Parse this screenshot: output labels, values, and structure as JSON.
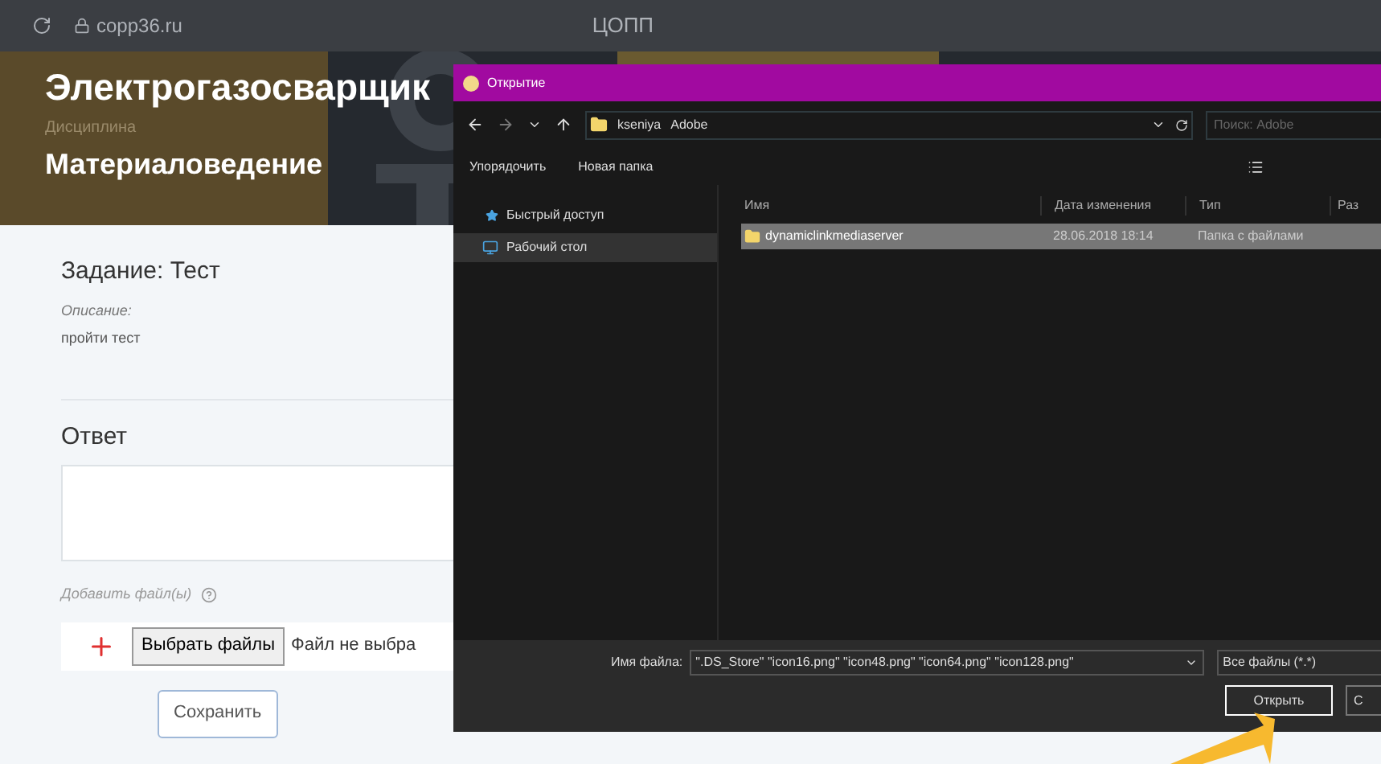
{
  "browser": {
    "url": "copp36.ru",
    "title": "ЦОПП"
  },
  "header": {
    "title": "Электрогазосварщик",
    "subtitle_label": "Дисциплина",
    "subtitle": "Материаловедение"
  },
  "task": {
    "title": "Задание: Тест",
    "description_label": "Описание:",
    "description": "пройти тест",
    "answer_label": "Ответ",
    "attach_label": "Добавить файл(ы)",
    "choose_button": "Выбрать файлы",
    "no_file": "Файл не выбра",
    "save_button": "Сохранить"
  },
  "dialog": {
    "title": "Открытие",
    "breadcrumbs": [
      "kseniya",
      "Adobe"
    ],
    "search": {
      "placeholder": "Поиск: Adobe"
    },
    "toolbar": [
      "Упорядочить",
      "Новая папка"
    ],
    "sidebar": [
      {
        "label": "Быстрый доступ",
        "kind": "star",
        "selected": false
      },
      {
        "label": "Рабочий стол",
        "kind": "desktop",
        "selected": true
      }
    ],
    "columns": [
      "Имя",
      "Дата изменения",
      "Тип",
      "Раз"
    ],
    "rows": [
      {
        "name": "dynamiclinkmediaserver",
        "date": "28.06.2018 18:14",
        "type": "Папка с файлами",
        "selected": true
      }
    ],
    "filename_label": "Имя файла:",
    "filename": "\".DS_Store\" \"icon16.png\" \"icon48.png\" \"icon64.png\" \"icon128.png\"",
    "filter": "Все файлы (*.*)",
    "buttons": [
      "Открыть",
      "С"
    ]
  }
}
